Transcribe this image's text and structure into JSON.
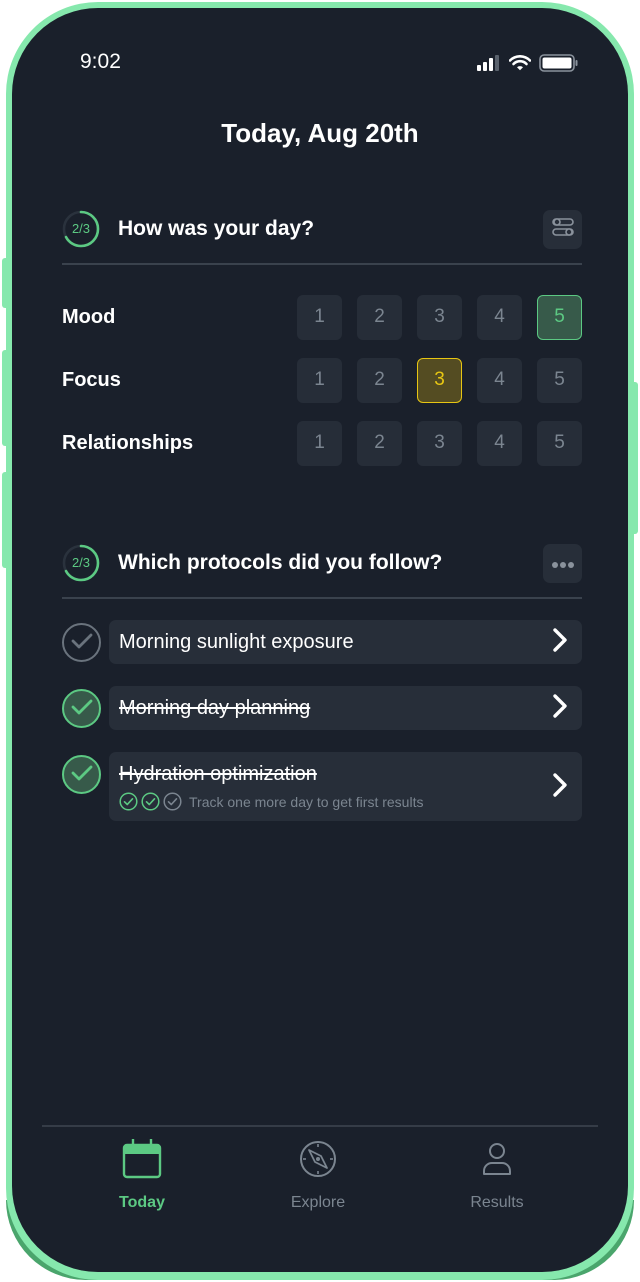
{
  "status_bar": {
    "time": "9:02",
    "icons": [
      "signal-icon",
      "wifi-icon",
      "battery-icon"
    ]
  },
  "page": {
    "title": "Today, Aug 20th"
  },
  "colors": {
    "accent_green": "#5cc983",
    "accent_yellow": "#e7c613",
    "background": "#1a202b",
    "card": "#272e39",
    "muted_text": "#7b8590",
    "frame": "#86e8ad"
  },
  "day_section": {
    "progress_label": "2/3",
    "progress_fraction": 0.67,
    "title": "How was your day?",
    "action_icon": "toggle-settings-icon",
    "ratings": [
      {
        "label": "Mood",
        "options": [
          "1",
          "2",
          "3",
          "4",
          "5"
        ],
        "selected": "5",
        "selected_color": "green"
      },
      {
        "label": "Focus",
        "options": [
          "1",
          "2",
          "3",
          "4",
          "5"
        ],
        "selected": "3",
        "selected_color": "yellow"
      },
      {
        "label": "Relationships",
        "options": [
          "1",
          "2",
          "3",
          "4",
          "5"
        ],
        "selected": null,
        "selected_color": null
      }
    ]
  },
  "protocol_section": {
    "progress_label": "2/3",
    "progress_fraction": 0.67,
    "title": "Which protocols did you follow?",
    "action_icon": "more-dots-icon",
    "protocols": [
      {
        "name": "Morning sunlight exposure",
        "completed": false
      },
      {
        "name": "Morning day planning",
        "completed": true
      },
      {
        "name": "Hydration optimization",
        "completed": true,
        "streak_days_done": 2,
        "streak_days_total": 3,
        "hint": "Track one more day to get first results"
      }
    ]
  },
  "tab_bar": {
    "tabs": [
      {
        "label": "Today",
        "icon": "calendar-icon",
        "active": true
      },
      {
        "label": "Explore",
        "icon": "compass-icon",
        "active": false
      },
      {
        "label": "Results",
        "icon": "user-icon",
        "active": false
      }
    ]
  }
}
